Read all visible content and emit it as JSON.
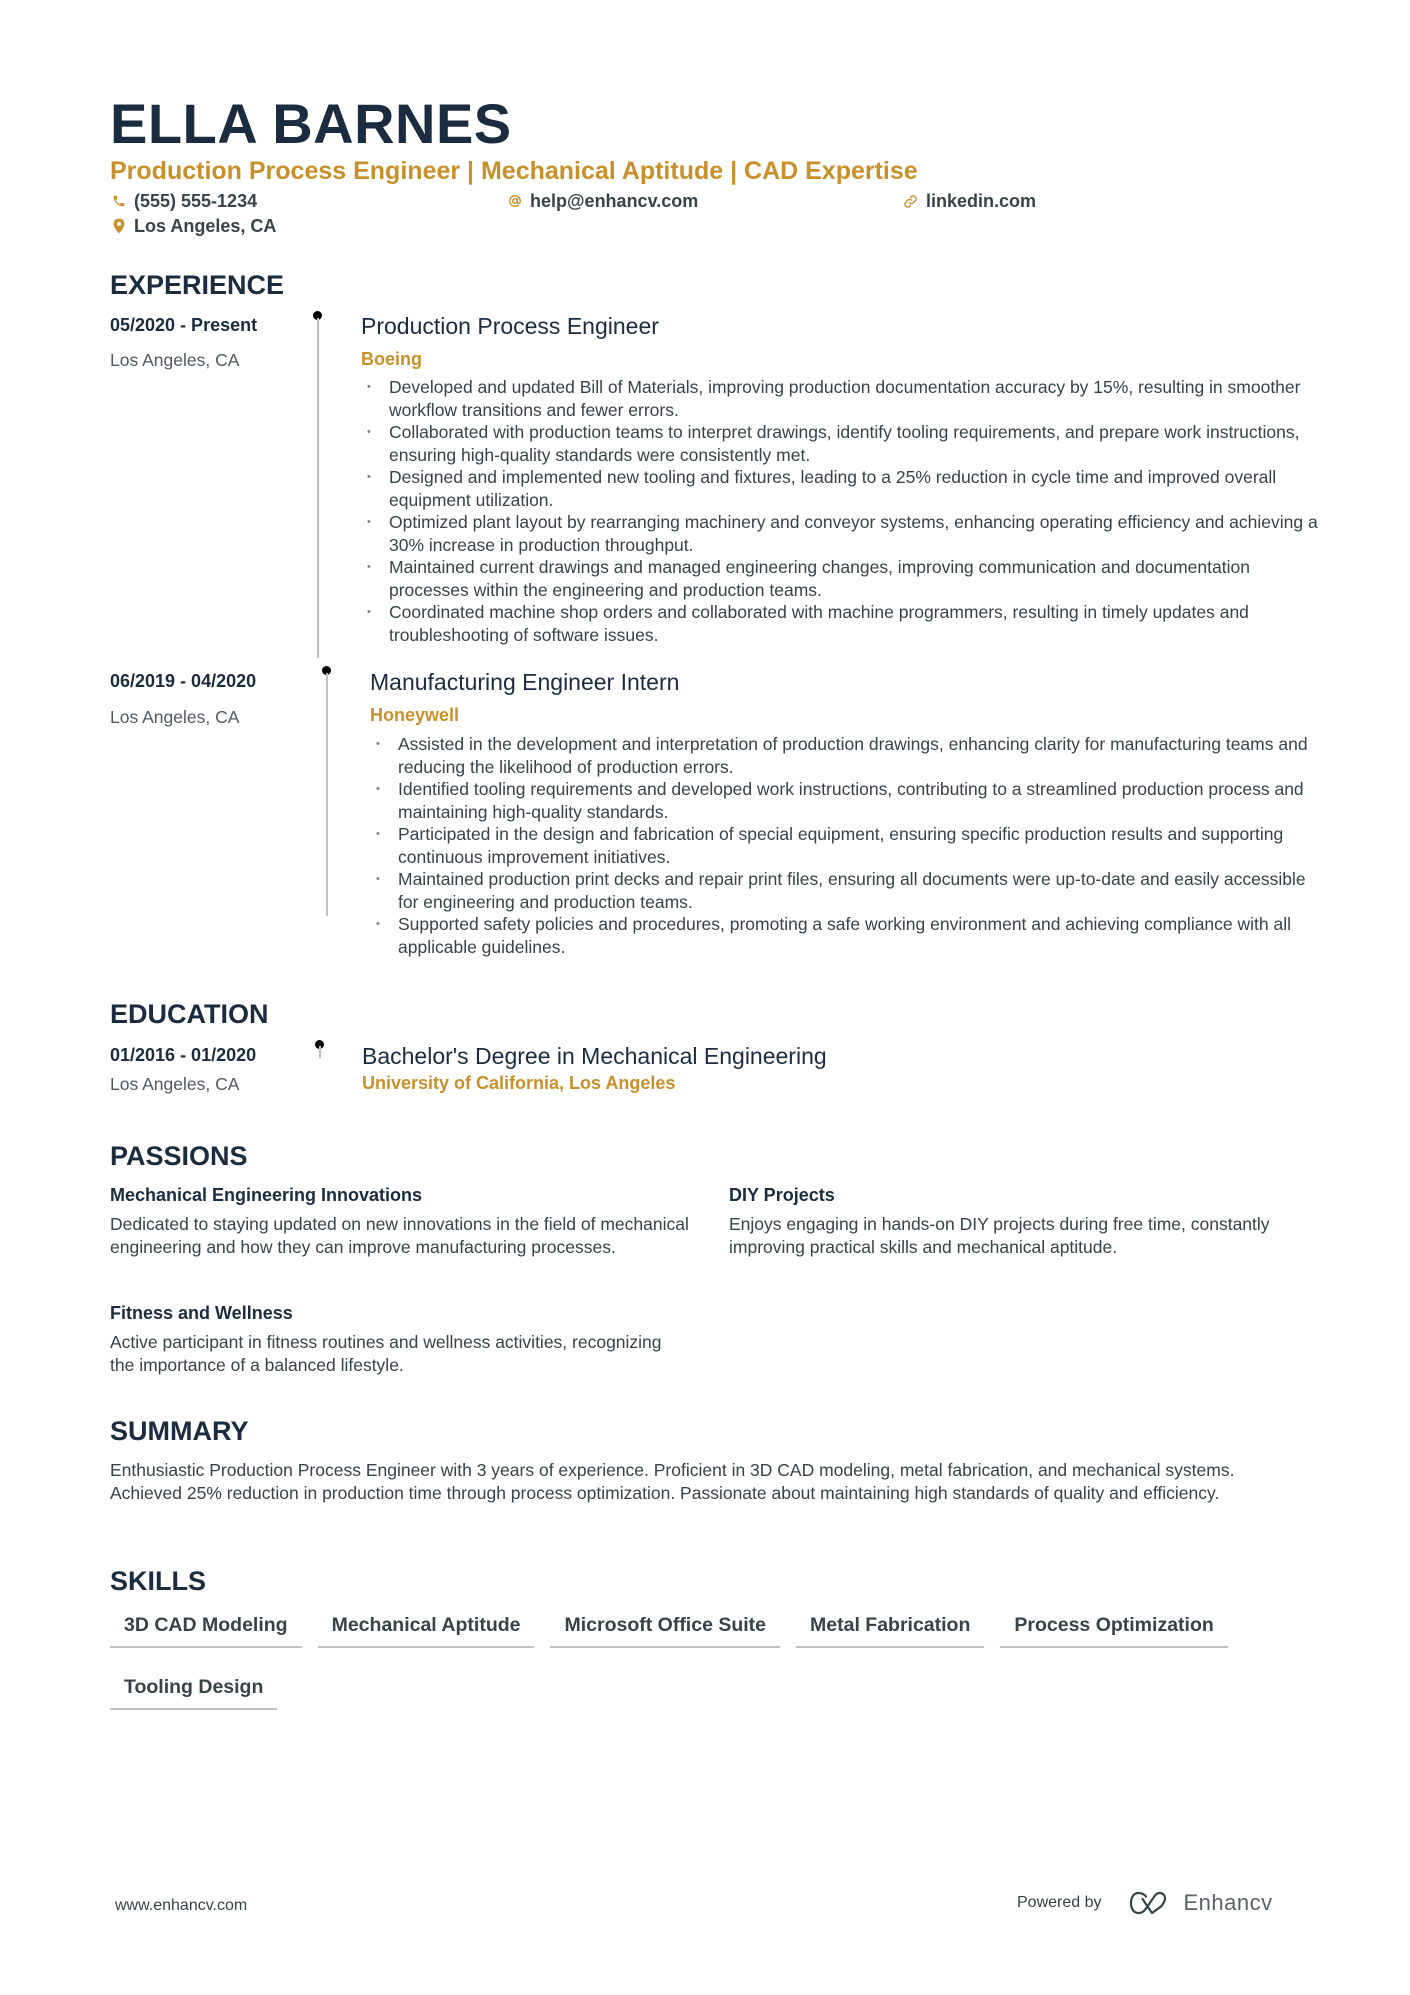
{
  "header": {
    "name": "ELLA BARNES",
    "headline": "Production Process Engineer | Mechanical Aptitude | CAD Expertise",
    "contact": {
      "phone": "(555) 555-1234",
      "email": "help@enhancv.com",
      "link": "linkedin.com",
      "location": "Los Angeles, CA"
    },
    "icons": {
      "phone": "phone-icon",
      "email": "at-icon",
      "link": "link-icon",
      "location": "location-pin-icon"
    }
  },
  "colors": {
    "accent": "#c8902a",
    "heading": "#1b2b40",
    "body": "#384347"
  },
  "sections": {
    "experience": "EXPERIENCE",
    "education": "EDUCATION",
    "passions": "PASSIONS",
    "summary": "SUMMARY",
    "skills": "SKILLS"
  },
  "experience": [
    {
      "dates": "05/2020 - Present",
      "location": "Los Angeles, CA",
      "role": "Production Process Engineer",
      "company": "Boeing",
      "bullets": [
        "Developed and updated Bill of Materials, improving production documentation accuracy by 15%, resulting in smoother workflow transitions and fewer errors.",
        "Collaborated with production teams to interpret drawings, identify tooling requirements, and prepare work instructions, ensuring high-quality standards were consistently met.",
        "Designed and implemented new tooling and fixtures, leading to a 25% reduction in cycle time and improved overall equipment utilization.",
        "Optimized plant layout by rearranging machinery and conveyor systems, enhancing operating efficiency and achieving a 30% increase in production throughput.",
        "Maintained current drawings and managed engineering changes, improving communication and documentation processes within the engineering and production teams.",
        "Coordinated machine shop orders and collaborated with machine programmers, resulting in timely updates and troubleshooting of software issues."
      ]
    },
    {
      "dates": "06/2019 - 04/2020",
      "location": "Los Angeles, CA",
      "role": "Manufacturing Engineer Intern",
      "company": "Honeywell",
      "bullets": [
        "Assisted in the development and interpretation of production drawings, enhancing clarity for manufacturing teams and reducing the likelihood of production errors.",
        "Identified tooling requirements and developed work instructions, contributing to a streamlined production process and maintaining high-quality standards.",
        "Participated in the design and fabrication of special equipment, ensuring specific production results and supporting continuous improvement initiatives.",
        "Maintained production print decks and repair print files, ensuring all documents were up-to-date and easily accessible for engineering and production teams.",
        "Supported safety policies and procedures, promoting a safe working environment and achieving compliance with all applicable guidelines."
      ]
    }
  ],
  "education": [
    {
      "dates": "01/2016 - 01/2020",
      "location": "Los Angeles, CA",
      "degree": "Bachelor's Degree in Mechanical Engineering",
      "school": "University of California, Los Angeles"
    }
  ],
  "passions": [
    {
      "title": "Mechanical Engineering Innovations",
      "description": "Dedicated to staying updated on new innovations in the field of mechanical engineering and how they can improve manufacturing processes."
    },
    {
      "title": "DIY Projects",
      "description": "Enjoys engaging in hands-on DIY projects during free time, constantly improving practical skills and mechanical aptitude."
    },
    {
      "title": "Fitness and Wellness",
      "description": "Active participant in fitness routines and wellness activities, recognizing the importance of a balanced lifestyle."
    }
  ],
  "summary": "Enthusiastic Production Process Engineer with 3 years of experience. Proficient in 3D CAD modeling, metal fabrication, and mechanical systems. Achieved 25% reduction in production time through process optimization. Passionate about maintaining high standards of quality and efficiency.",
  "skills": [
    "3D CAD Modeling",
    "Mechanical Aptitude",
    "Microsoft Office Suite",
    "Metal Fabrication",
    "Process Optimization",
    "Tooling Design"
  ],
  "footer": {
    "website": "www.enhancv.com",
    "powered_by": "Powered by",
    "brand": "Enhancv",
    "brand_icon": "enhancv-logo-icon"
  }
}
